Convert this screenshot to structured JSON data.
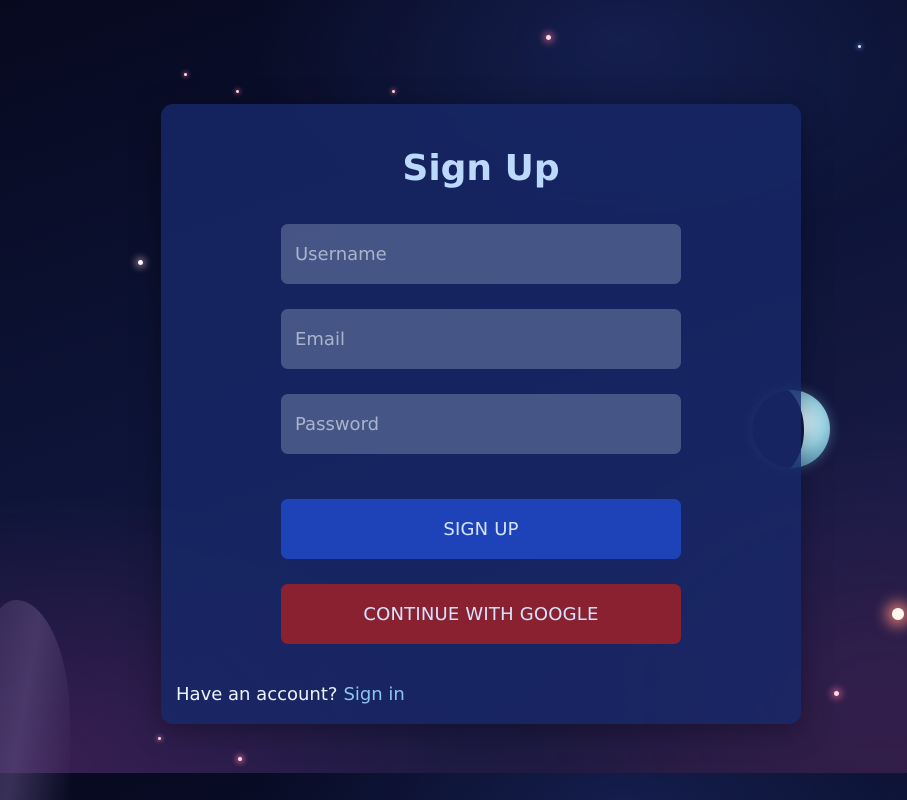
{
  "form": {
    "title": "Sign Up",
    "fields": {
      "username": {
        "placeholder": "Username",
        "value": ""
      },
      "email": {
        "placeholder": "Email",
        "value": ""
      },
      "password": {
        "placeholder": "Password",
        "value": ""
      }
    },
    "signup_button_label": "SIGN UP",
    "google_button_label": "CONTINUE WITH GOOGLE",
    "footer": {
      "prompt": "Have an account?",
      "link_label": "Sign in"
    }
  },
  "colors": {
    "card_background": "#172869",
    "title": "#bcd8fb",
    "signup_button": "#1e43b8",
    "google_button": "#8a2130",
    "link": "#8fc2f5",
    "button_text": "#d6e3ff"
  },
  "icons": {
    "planet": "planet-icon"
  }
}
